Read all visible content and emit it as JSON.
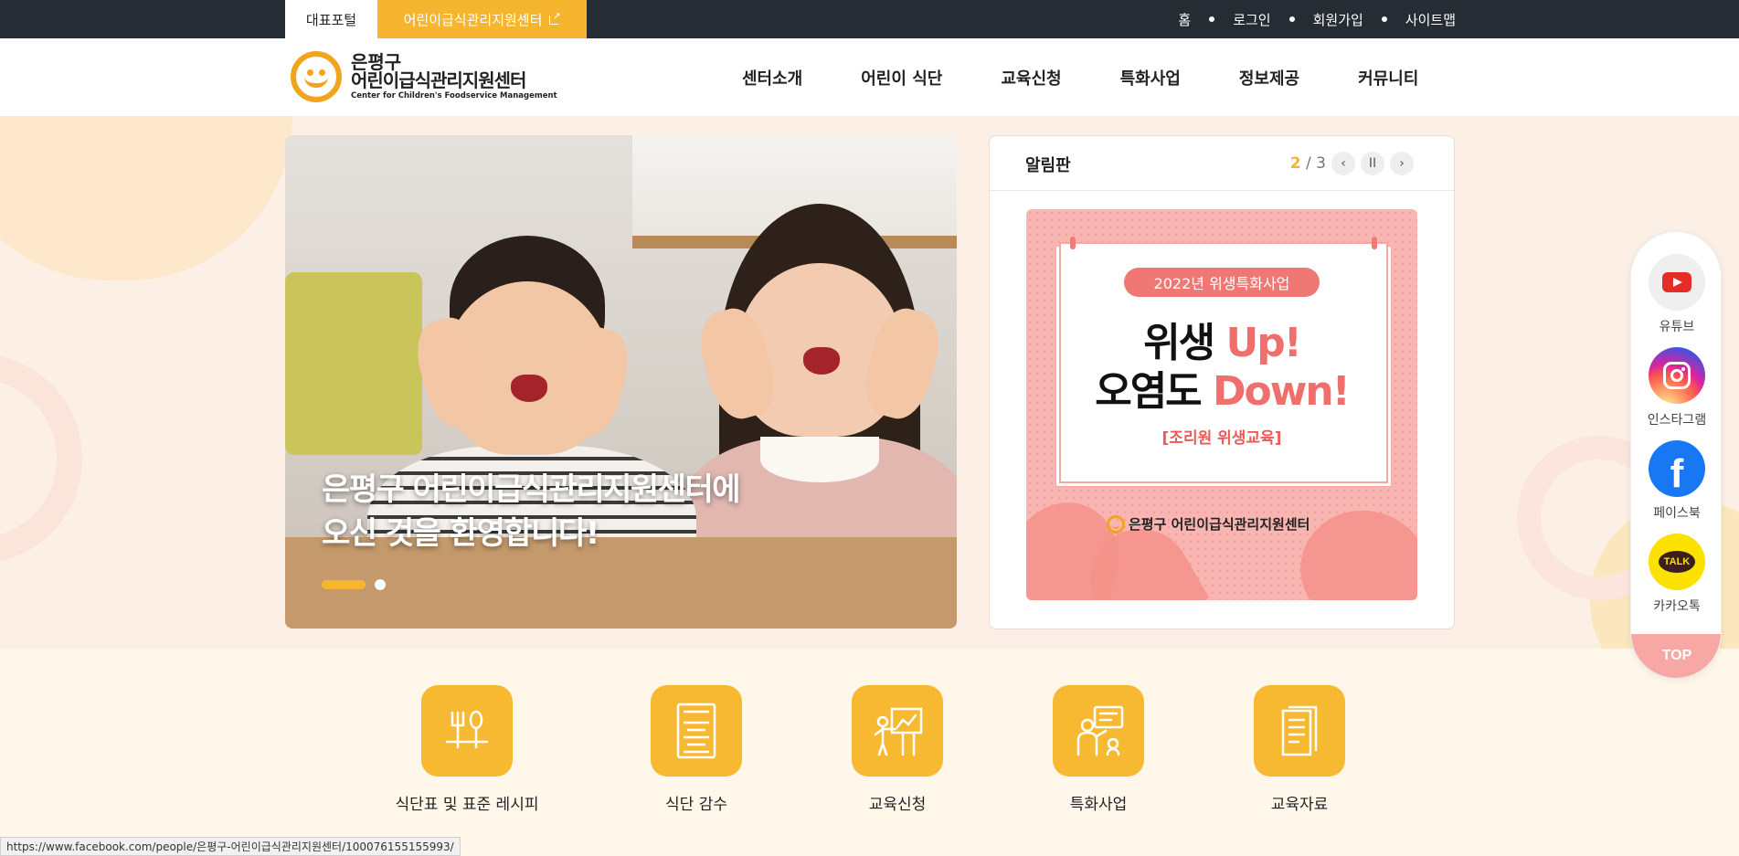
{
  "topbar": {
    "tab_portal": "대표포털",
    "tab_center": "어린이급식관리지원센터",
    "util": [
      "홈",
      "로그인",
      "회원가입",
      "사이트맵"
    ]
  },
  "logo": {
    "line1": "은평구",
    "line2": "어린이급식관리지원센터",
    "line3": "Center for Children's Foodservice Management"
  },
  "gnb": [
    "센터소개",
    "어린이 식단",
    "교육신청",
    "특화사업",
    "정보제공",
    "커뮤니티"
  ],
  "hero": {
    "caption_line1": "은평구 어린이급식관리지원센터에",
    "caption_line2": "오신 것을 환영합니다!",
    "slide_count": 2,
    "active_slide": 1
  },
  "board": {
    "title": "알림판",
    "current": "2",
    "divider": "/",
    "total": "3",
    "prev": "‹",
    "pause": "II",
    "next": "›",
    "poster": {
      "pill": "2022년 위생특화사업",
      "line1_a": "위생 ",
      "line1_b": "Up!",
      "line2_a": "오염도 ",
      "line2_b": "Down!",
      "sub": "[조리원 위생교육]",
      "brand": "은평구 어린이급식관리지원센터"
    }
  },
  "quick": [
    {
      "label": "식단표 및 표준 레시피",
      "icon": "utensils-icon"
    },
    {
      "label": "식단 감수",
      "icon": "menu-board-icon"
    },
    {
      "label": "교육신청",
      "icon": "presentation-icon"
    },
    {
      "label": "특화사업",
      "icon": "teacher-icon"
    },
    {
      "label": "교육자료",
      "icon": "document-icon"
    }
  ],
  "sns": {
    "youtube": "유튜브",
    "instagram": "인스타그램",
    "facebook": "페이스북",
    "facebook_glyph": "f",
    "kakao": "카카오톡",
    "kakao_glyph": "TALK",
    "top": "TOP"
  },
  "status_url": "https://www.facebook.com/people/은평구-어린이급식관리지원센터/100076155155993/",
  "colors": {
    "accent": "#f5b52e",
    "topbar": "#262c33",
    "band": "#fcf0e6",
    "quick_bg": "#fff8ea",
    "poster_pink": "#f9b5b2"
  }
}
